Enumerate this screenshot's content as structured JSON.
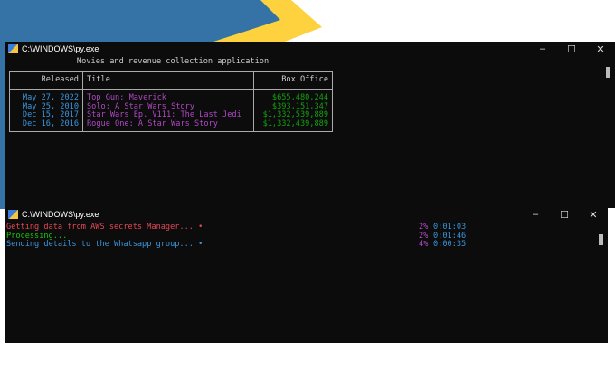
{
  "window1": {
    "title": "C:\\WINDOWS\\py.exe",
    "heading": "Movies and revenue collection application",
    "columns": [
      "Released",
      "Title",
      "Box Office"
    ],
    "rows": [
      {
        "released": "May 27, 2022",
        "title": "Top Gun: Maverick",
        "box_office": "$655,480,244"
      },
      {
        "released": "May 25, 2010",
        "title": "Solo: A Star Wars Story",
        "box_office": "$393,151,347"
      },
      {
        "released": "Dec 15, 2017",
        "title": "Star Wars Ep. V111: The Last Jedi",
        "box_office": "$1,332,539,889"
      },
      {
        "released": "Dec 16, 2016",
        "title": "Rogue One: A Star Wars Story",
        "box_office": "$1,332,439,889"
      }
    ]
  },
  "window2": {
    "title": "C:\\WINDOWS\\py.exe",
    "lines": [
      {
        "text": "Getting data from AWS secrets Manager... •",
        "percent": "2%",
        "time": "0:01:03",
        "color": "#e74856"
      },
      {
        "text": "Processing...",
        "percent": "2%",
        "time": "0:01:46",
        "color": "#16c60c"
      },
      {
        "text": "Sending details to the Whatsapp group... •",
        "percent": "4%",
        "time": "0:00:35",
        "color": "#3a96dd"
      }
    ]
  },
  "controls": {
    "minimize": "–",
    "maximize": "☐",
    "close": "✕"
  }
}
